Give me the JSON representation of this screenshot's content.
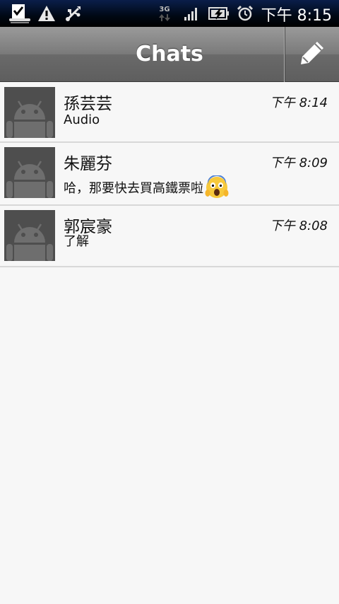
{
  "status_bar": {
    "time": "下午 8:15",
    "network_label": "3G",
    "icons": [
      "download-complete-icon",
      "warning-icon",
      "usb-icon",
      "network-3g-icon",
      "signal-icon",
      "battery-charging-icon",
      "alarm-icon"
    ]
  },
  "title_bar": {
    "title": "Chats",
    "compose_icon": "pencil-icon"
  },
  "chats": [
    {
      "name": "孫芸芸",
      "time": "下午 8:14",
      "message": "Audio"
    },
    {
      "name": "朱麗芬",
      "time": "下午 8:09",
      "message": "哈，那要快去買高鐵票啦",
      "emoji": "screaming-face-emoji"
    },
    {
      "name": "郭宸豪",
      "time": "下午 8:08",
      "message": "了解"
    }
  ],
  "colors": {
    "status_bar_bg": "#000814",
    "title_bar_bg": "#7a7a7a",
    "list_bg": "#f7f7f7",
    "divider": "#d8d8d8",
    "avatar_bg": "#4e4e4e"
  }
}
